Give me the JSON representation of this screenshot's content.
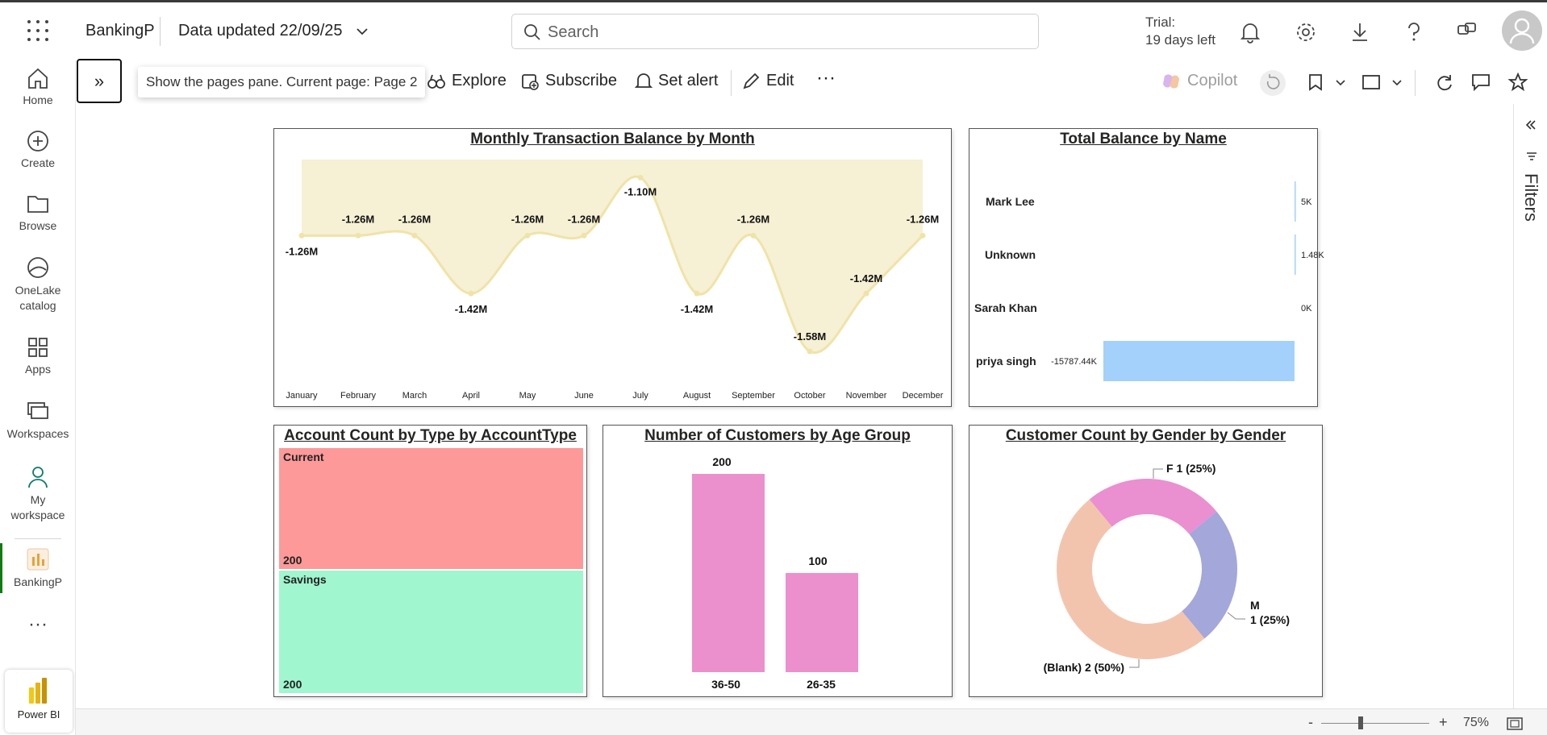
{
  "app": {
    "report_name": "BankingP",
    "data_updated": "Data updated 22/09/25",
    "search_placeholder": "Search",
    "trial_line1": "Trial:",
    "trial_line2": "19 days left"
  },
  "rail": {
    "items": [
      {
        "label": "Home",
        "icon": "home-icon"
      },
      {
        "label": "Create",
        "icon": "create-icon"
      },
      {
        "label": "Browse",
        "icon": "folder-icon"
      },
      {
        "label1": "OneLake",
        "label2": "catalog",
        "icon": "onelake-icon"
      },
      {
        "label": "Apps",
        "icon": "apps-icon"
      },
      {
        "label": "Workspaces",
        "icon": "workspaces-icon"
      },
      {
        "label1": "My",
        "label2": "workspace",
        "icon": "my-workspace-icon"
      },
      {
        "label": "BankingP",
        "icon": "report-icon"
      }
    ],
    "more": "···",
    "power_bi": "Power BI"
  },
  "toolbar": {
    "pane_glyph": "»",
    "tooltip": "Show the pages pane. Current page: Page 2",
    "explore": "Explore",
    "subscribe": "Subscribe",
    "set_alert": "Set alert",
    "edit": "Edit",
    "more": "···",
    "copilot": "Copilot"
  },
  "filters": {
    "label": "Filters"
  },
  "status": {
    "minus": "-",
    "plus": "+",
    "zoom": "75%"
  },
  "colors": {
    "area": "#f0e3a8",
    "area_fill": "#f6f0d4",
    "bar_blue": "#a3d1fb",
    "treemap_current": "#fd9999",
    "treemap_savings": "#a0f6cf",
    "bar_pink": "#ec8fcd",
    "donut_f": "#ea8fd0",
    "donut_m": "#a3a7da",
    "donut_blank": "#f3c4ad",
    "rail_active": "#107c10"
  },
  "chart_data": [
    {
      "type": "area",
      "title": "Monthly Transaction Balance by Month",
      "categories": [
        "January",
        "February",
        "March",
        "April",
        "May",
        "June",
        "July",
        "August",
        "September",
        "October",
        "November",
        "December"
      ],
      "values": [
        -1.26,
        -1.26,
        -1.26,
        -1.42,
        -1.26,
        -1.26,
        -1.1,
        -1.42,
        -1.26,
        -1.58,
        -1.42,
        -1.26
      ],
      "labels": [
        "-1.26M",
        "-1.26M",
        "-1.26M",
        "-1.42M",
        "-1.26M",
        "-1.26M",
        "-1.10M",
        "-1.42M",
        "-1.26M",
        "-1.58M",
        "-1.42M",
        "-1.26M"
      ],
      "unit": "M",
      "grid": false
    },
    {
      "type": "bar",
      "orientation": "horizontal",
      "title": "Total Balance by Name",
      "categories": [
        "Mark Lee",
        "Unknown",
        "Sarah Khan",
        "priya singh"
      ],
      "values": [
        5,
        1.48,
        0,
        -15787.44
      ],
      "labels": [
        "5K",
        "1.48K",
        "0K",
        "-15787.44K"
      ],
      "unit": "K"
    },
    {
      "type": "treemap",
      "title": "Account Count by Type by AccountType",
      "categories": [
        "Current",
        "Savings"
      ],
      "values": [
        200,
        200
      ],
      "labels": [
        "200",
        "200"
      ]
    },
    {
      "type": "bar",
      "title": "Number of Customers by Age Group",
      "categories": [
        "36-50",
        "26-35"
      ],
      "values": [
        200,
        100
      ],
      "labels": [
        "200",
        "100"
      ]
    },
    {
      "type": "pie",
      "donut": true,
      "title": "Customer Count by Gender by Gender",
      "categories": [
        "F",
        "M",
        "(Blank)"
      ],
      "values": [
        1,
        1,
        2
      ],
      "labels": [
        "F 1 (25%)",
        "M",
        "1 (25%)",
        "(Blank) 2 (50%)"
      ]
    }
  ]
}
